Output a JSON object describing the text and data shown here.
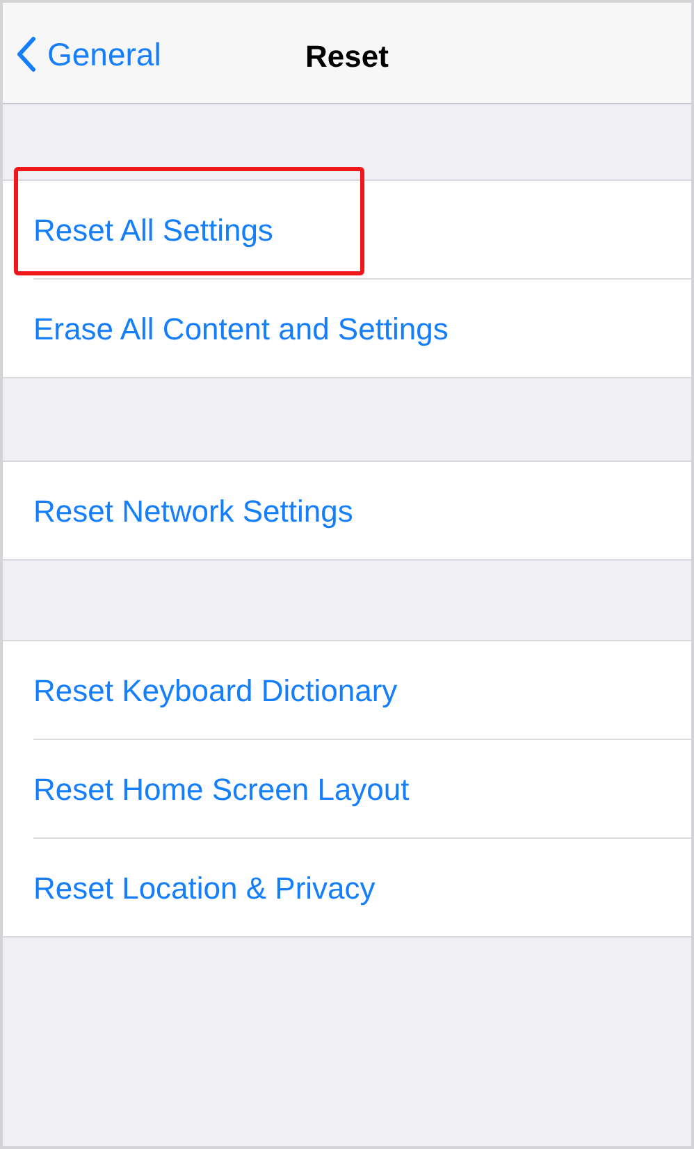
{
  "nav": {
    "back_label": "General",
    "title": "Reset"
  },
  "groups": [
    {
      "items": [
        {
          "label": "Reset All Settings",
          "highlighted": true
        },
        {
          "label": "Erase All Content and Settings",
          "highlighted": false
        }
      ]
    },
    {
      "items": [
        {
          "label": "Reset Network Settings",
          "highlighted": false
        }
      ]
    },
    {
      "items": [
        {
          "label": "Reset Keyboard Dictionary",
          "highlighted": false
        },
        {
          "label": "Reset Home Screen Layout",
          "highlighted": false
        },
        {
          "label": "Reset Location & Privacy",
          "highlighted": false
        }
      ]
    }
  ]
}
